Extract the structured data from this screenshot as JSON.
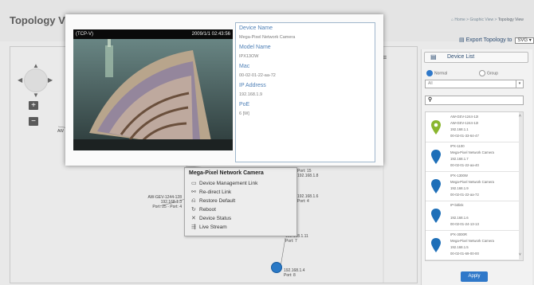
{
  "page": {
    "title": "Topology View"
  },
  "breadcrumb": {
    "home": "Home",
    "section": "Graphic View",
    "current": "Topology View"
  },
  "export": {
    "label": "Export Topology to",
    "format": "SVG"
  },
  "zoom": {
    "in_label": "+",
    "out_label": "−"
  },
  "canvas_labels": [
    {
      "text": "AW"
    },
    {
      "text": "AW-GEV-1244-128"
    },
    {
      "text": "192.168.1.3"
    },
    {
      "text": "Port: 25 - Port: 4"
    },
    {
      "text": "Port: 15"
    },
    {
      "text": "192.168.1.8"
    },
    {
      "text": "192.168.1.6"
    },
    {
      "text": "Port: 4"
    },
    {
      "text": "Port: 8"
    },
    {
      "text": "192.168.1.11"
    },
    {
      "text": "Port: 7"
    },
    {
      "text": "192.168.1.4"
    },
    {
      "text": "Port: 8"
    }
  ],
  "context_menu": {
    "title": "Mega-Pixel Network Camera",
    "items": [
      {
        "label": "Device Management Link",
        "icon": "monitor-icon"
      },
      {
        "label": "Re-direct Link",
        "icon": "link-icon"
      },
      {
        "label": "Restore Default",
        "icon": "restore-icon"
      },
      {
        "label": "Reboot",
        "icon": "reboot-icon"
      },
      {
        "label": "Device Status",
        "icon": "status-icon"
      },
      {
        "label": "Live Stream",
        "icon": "stream-icon"
      }
    ]
  },
  "camera_popup": {
    "channel": "(TCP-V)",
    "timestamp": "2009/1/1 02:43:56",
    "fields": [
      {
        "key": "Device Name",
        "value": "Mega-Pixel Network Camera"
      },
      {
        "key": "Model Name",
        "value": "IPX13OW"
      },
      {
        "key": "Mac",
        "value": "00-02-01-22-aa-72"
      },
      {
        "key": "IP Address",
        "value": "192.168.1.9"
      },
      {
        "key": "PoE",
        "value": "6 [W]"
      }
    ]
  },
  "device_list": {
    "title": "Device List",
    "radio_normal": "Normal",
    "radio_group": "Group",
    "filter_value": "All",
    "devices": [
      {
        "lines": [
          "AW-GEV-1244-12I",
          "AW-GEV-1244-12I",
          "192.168.1.1",
          "00-02-01-33-64-47"
        ],
        "color": "#8ab62f"
      },
      {
        "lines": [
          "IPX-1100",
          "Mega-Pixel Network Camera",
          "192.168.1.7",
          "00-02-01-22-aa-40"
        ],
        "color": "#1e6fb8"
      },
      {
        "lines": [
          "IPX-1300W",
          "Mega-Pixel Network Camera",
          "192.168.1.9",
          "00-02-01-22-aa-72"
        ],
        "color": "#1e6fb8"
      },
      {
        "lines": [
          "IP-bitlink",
          "",
          "192.168.1.6",
          "00-02-01-24-13-13"
        ],
        "color": "#1e6fb8"
      },
      {
        "lines": [
          "IPX-3000R",
          "Mega-Pixel Network Camera",
          "192.168.1.5",
          "00-02-01-69-00-00"
        ],
        "color": "#1e6fb8"
      }
    ],
    "apply_label": "Apply"
  },
  "colors": {
    "accent": "#2f78c9",
    "key_text": "#4d7fb6",
    "switch_pin": "#8ab62f",
    "camera_pin": "#1e6fb8"
  }
}
